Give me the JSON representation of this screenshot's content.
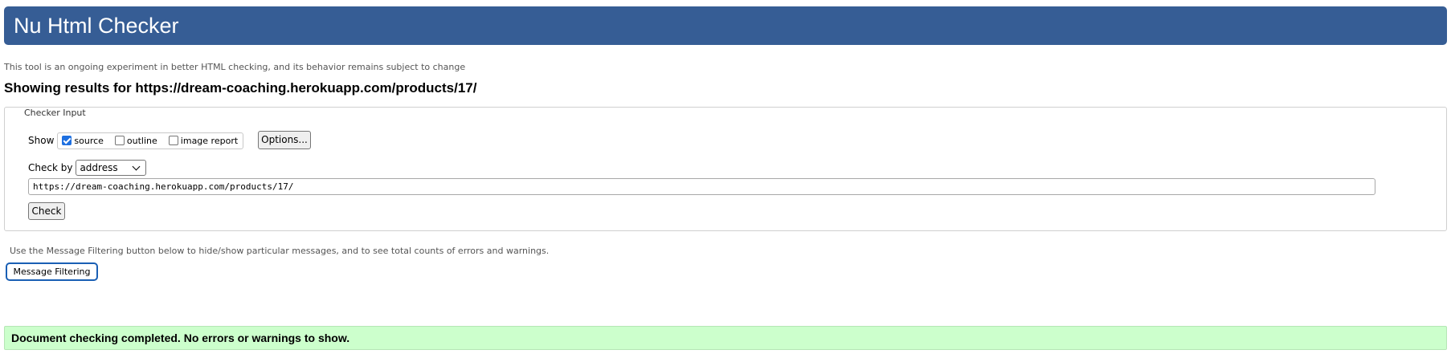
{
  "header": {
    "title": "Nu Html Checker",
    "background_color": "#365d95"
  },
  "intro": "This tool is an ongoing experiment in better HTML checking, and its behavior remains subject to change",
  "results_heading": "Showing results for https://dream-coaching.herokuapp.com/products/17/",
  "checker_input": {
    "legend": "Checker Input",
    "show_label": "Show",
    "show_options": [
      {
        "label": "source",
        "checked": true
      },
      {
        "label": "outline",
        "checked": false
      },
      {
        "label": "image report",
        "checked": false
      }
    ],
    "options_button": "Options...",
    "check_by_label": "Check by",
    "check_by_value": "address",
    "url_value": "https://dream-coaching.herokuapp.com/products/17/",
    "check_button": "Check"
  },
  "filter_note": "Use the Message Filtering button below to hide/show particular messages, and to see total counts of errors and warnings.",
  "message_filtering_button": "Message Filtering",
  "success_message": "Document checking completed. No errors or warnings to show.",
  "success_color": "#ccffcc"
}
